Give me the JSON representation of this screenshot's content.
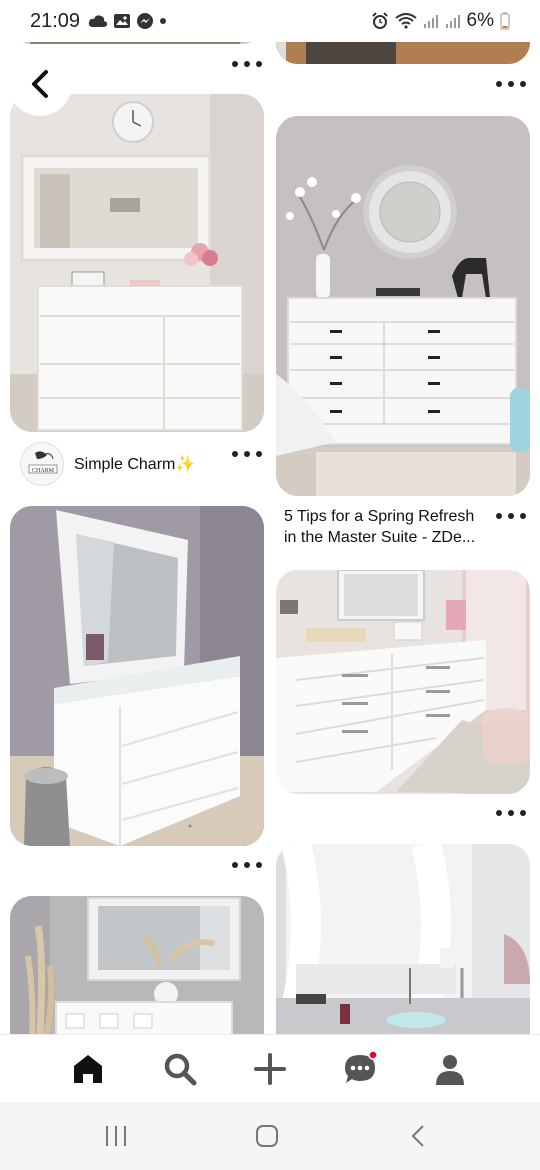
{
  "status": {
    "time": "21:09",
    "battery": "6%"
  },
  "pins": {
    "left_2": {
      "creator_name": "Simple Charm✨",
      "avatar_text": "CHARM"
    },
    "right_2": {
      "title_line1": "5 Tips for a Spring Refresh",
      "title_line2": "in the Master Suite - ZDe..."
    }
  },
  "icons": {
    "back": "back-arrow-icon",
    "more": "more-dots-icon",
    "home": "home-icon",
    "search": "search-icon",
    "create": "plus-icon",
    "messages": "chat-icon",
    "profile": "profile-icon"
  },
  "colors": {
    "notification_dot": "#e60023",
    "nav_icon": "#111111"
  }
}
